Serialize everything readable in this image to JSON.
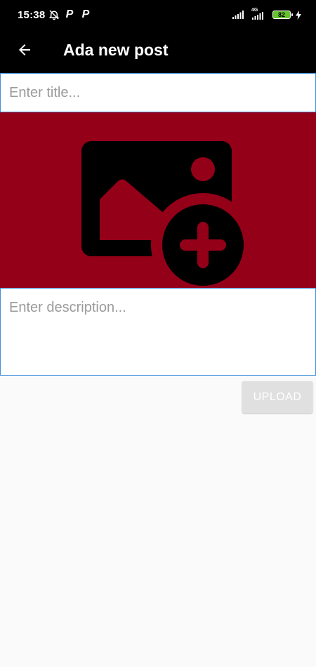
{
  "status_bar": {
    "time": "15:38",
    "pay_icon_letter": "P",
    "network_label": "4G",
    "battery_level": "82",
    "icons": [
      "alarm-off-icon",
      "pay-icon",
      "pay-icon",
      "signal-icon",
      "signal-4g-icon",
      "battery-icon",
      "charging-icon"
    ]
  },
  "app_bar": {
    "title": "Ada new post",
    "back_icon": "arrow-back-icon"
  },
  "form": {
    "title_placeholder": "Enter title...",
    "title_value": "",
    "image_picker_icon": "add-photo-icon",
    "description_placeholder": "Enter description...",
    "description_value": "",
    "upload_label": "UPLOAD"
  },
  "colors": {
    "app_bar_bg": "#000000",
    "image_picker_bg": "#950019",
    "input_border": "#3f8ed9",
    "upload_button_bg": "#e0e0e0",
    "battery_fill": "#66c32c",
    "page_bg": "#fafafa"
  }
}
